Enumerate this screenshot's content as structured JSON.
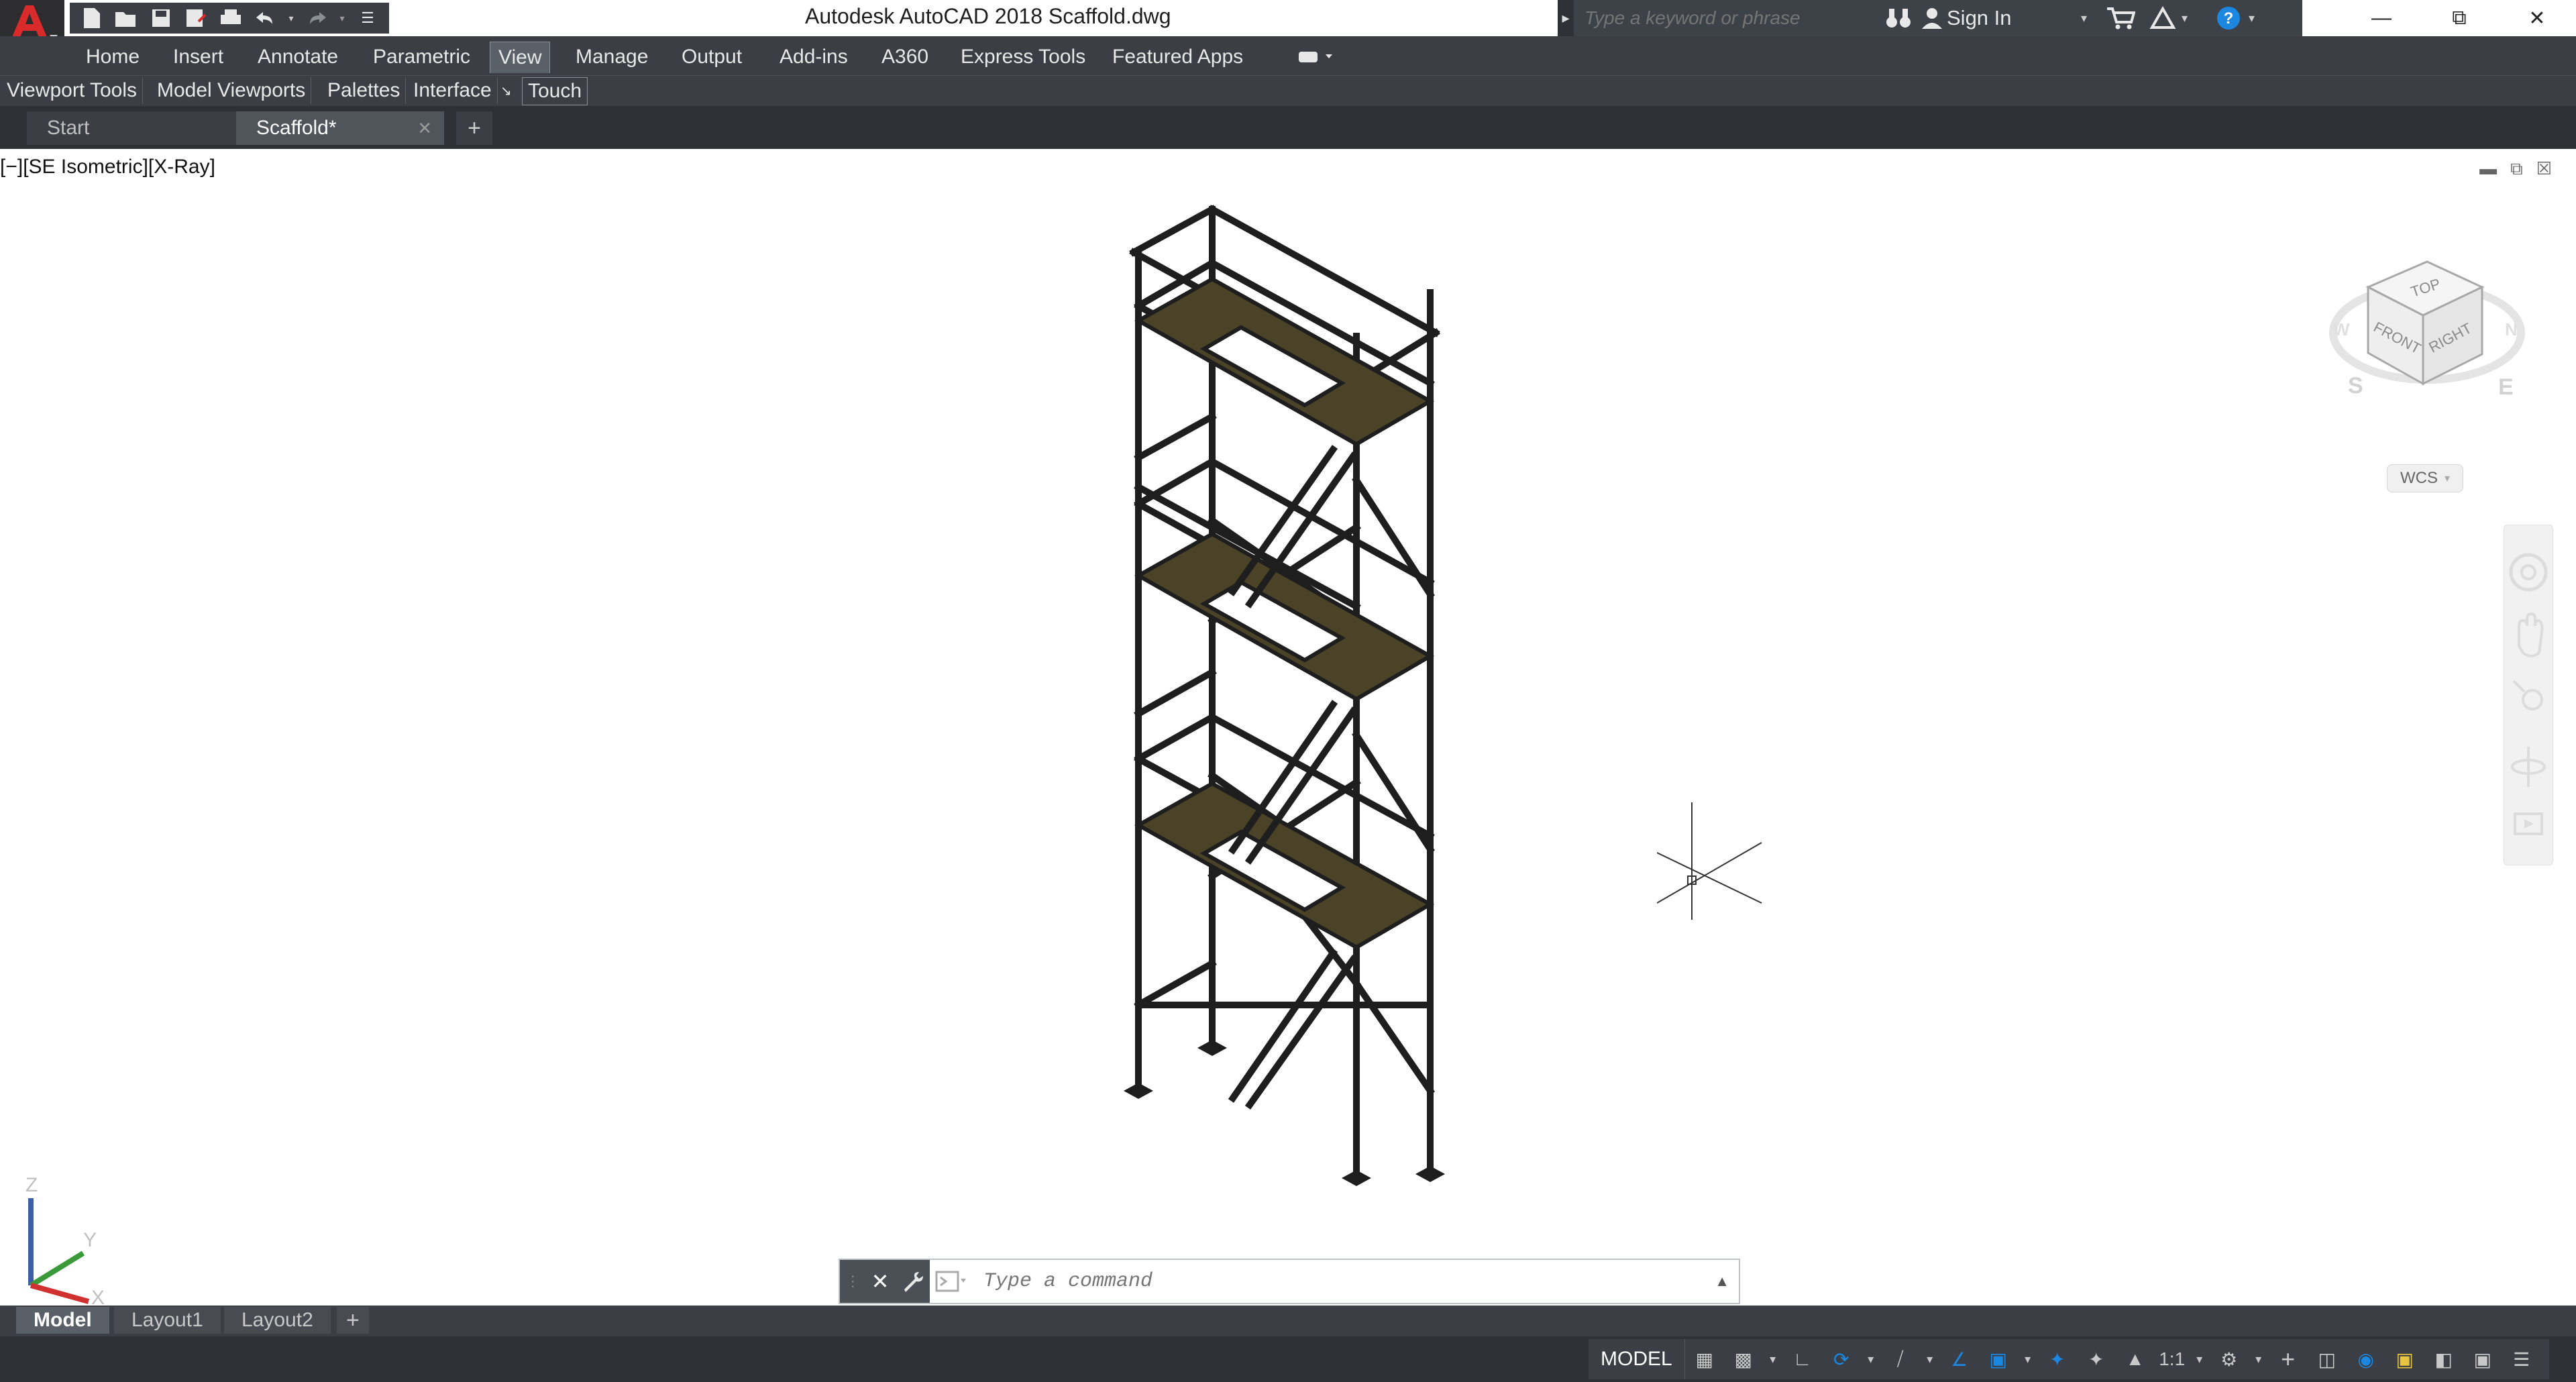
{
  "window": {
    "title": "Autodesk AutoCAD 2018    Scaffold.dwg",
    "search_placeholder": "Type a keyword or phrase",
    "sign_in": "Sign In"
  },
  "ribbon": {
    "tabs": [
      "Home",
      "Insert",
      "Annotate",
      "Parametric",
      "View",
      "Manage",
      "Output",
      "Add-ins",
      "A360",
      "Express Tools",
      "Featured Apps"
    ],
    "active_tab": "View",
    "panels": [
      "Viewport Tools",
      "Model Viewports",
      "Palettes",
      "Interface",
      "Touch"
    ]
  },
  "file_tabs": {
    "start": "Start",
    "active": "Scaffold*"
  },
  "viewport": {
    "label": "[−][SE Isometric][X-Ray]",
    "viewcube": {
      "top": "TOP",
      "front": "FRONT",
      "right": "RIGHT",
      "south": "S",
      "east": "E",
      "west": "W",
      "north": "N"
    },
    "wcs": "WCS",
    "ucs": {
      "x": "X",
      "y": "Y",
      "z": "Z"
    }
  },
  "command_line": {
    "placeholder": "Type a command"
  },
  "layout_tabs": [
    "Model",
    "Layout1",
    "Layout2"
  ],
  "status_bar": {
    "model": "MODEL",
    "scale": "1:1"
  },
  "colors": {
    "dark_ui": "#3b3f45",
    "plank": "#4a4328",
    "frame": "#1e1e1e",
    "accent_blue": "#1b87e0"
  }
}
